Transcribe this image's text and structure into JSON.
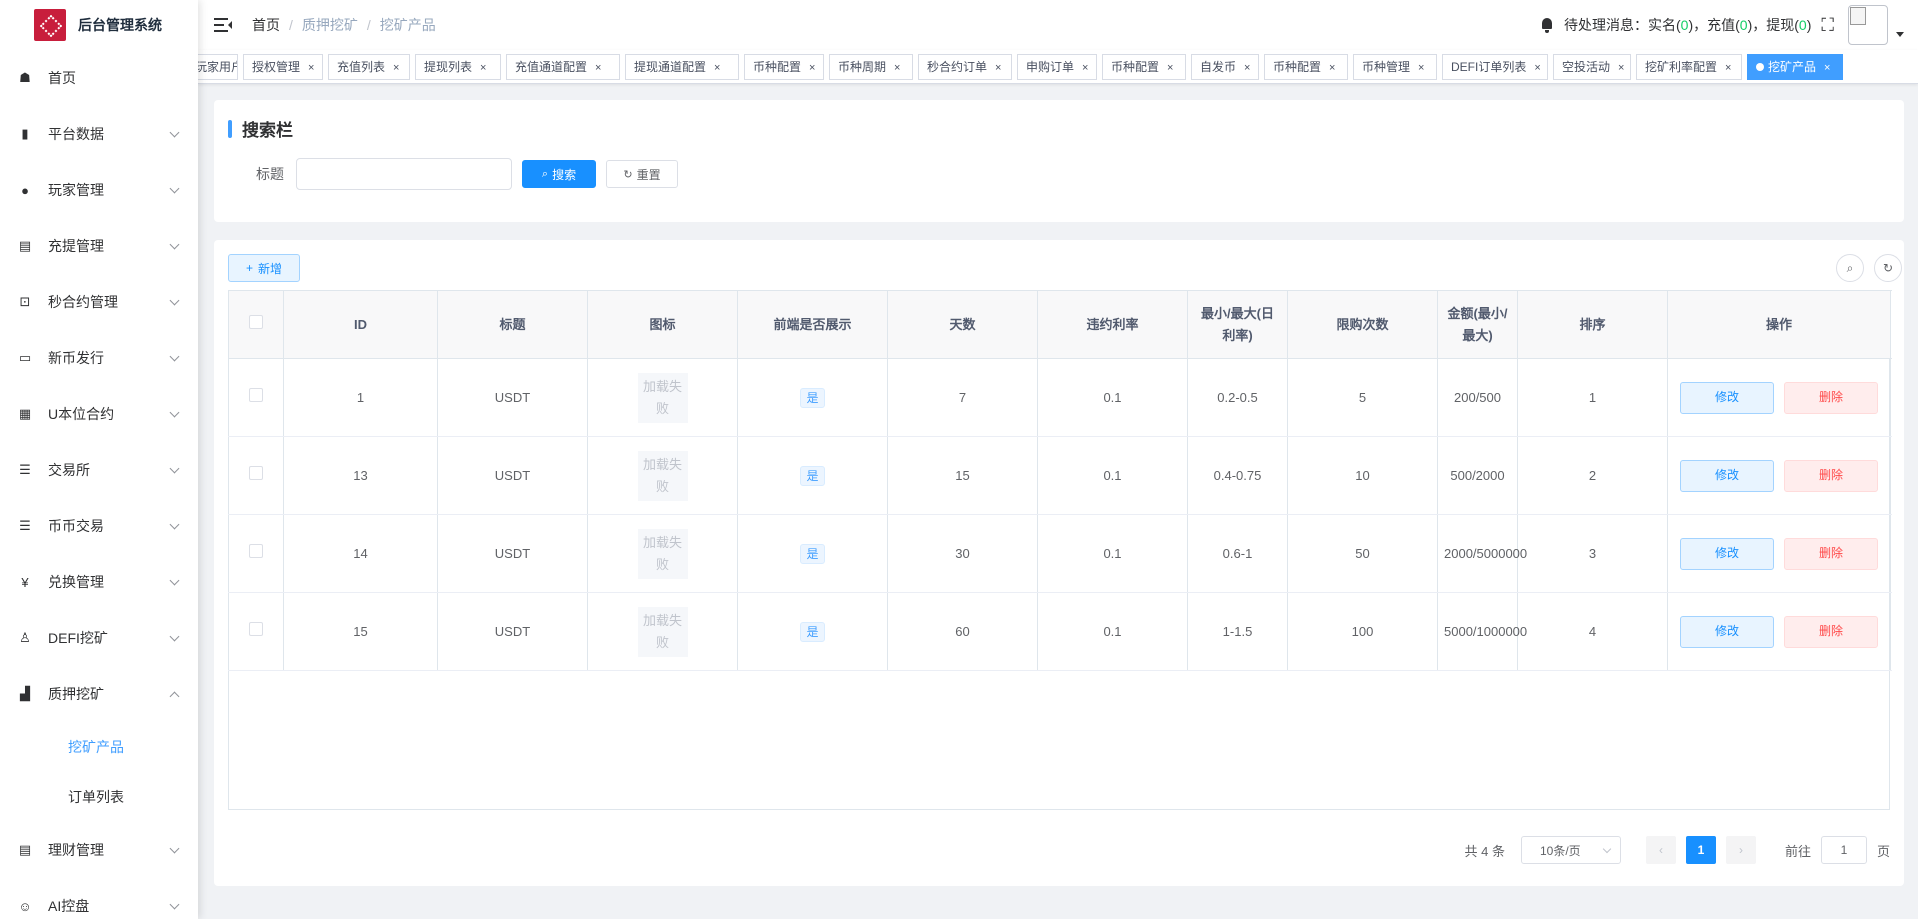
{
  "app": {
    "title": "后台管理系统"
  },
  "sidebar": {
    "items": [
      {
        "label": "首页",
        "icon": "dashboard-icon",
        "glyph": "☗",
        "expandable": false
      },
      {
        "label": "平台数据",
        "icon": "book-icon",
        "glyph": "▮",
        "expandable": true
      },
      {
        "label": "玩家管理",
        "icon": "user-icon",
        "glyph": "●",
        "expandable": true
      },
      {
        "label": "充提管理",
        "icon": "documents-icon",
        "glyph": "▤",
        "expandable": true
      },
      {
        "label": "秒合约管理",
        "icon": "monitor-chart-icon",
        "glyph": "⊡",
        "expandable": true
      },
      {
        "label": "新币发行",
        "icon": "edit-box-icon",
        "glyph": "▭",
        "expandable": true
      },
      {
        "label": "U本位合约",
        "icon": "grid-icon",
        "glyph": "▦",
        "expandable": true
      },
      {
        "label": "交易所",
        "icon": "list-icon",
        "glyph": "☰",
        "expandable": true
      },
      {
        "label": "币币交易",
        "icon": "list-bullet-icon",
        "glyph": "☰",
        "expandable": true
      },
      {
        "label": "兑换管理",
        "icon": "yen-icon",
        "glyph": "¥",
        "expandable": true
      },
      {
        "label": "DEFI挖矿",
        "icon": "person-tree-icon",
        "glyph": "♙",
        "expandable": true
      },
      {
        "label": "质押挖矿",
        "icon": "bar-chart-icon",
        "glyph": "▟",
        "expandable": true,
        "open": true
      }
    ],
    "sub_items": [
      {
        "label": "挖矿产品",
        "active": true
      },
      {
        "label": "订单列表",
        "active": false
      }
    ],
    "items_after": [
      {
        "label": "理财管理",
        "icon": "document-icon",
        "glyph": "▤",
        "expandable": true
      },
      {
        "label": "AI控盘",
        "icon": "robot-icon",
        "glyph": "☺",
        "expandable": true
      }
    ]
  },
  "header": {
    "breadcrumb": [
      "首页",
      "质押挖矿",
      "挖矿产品"
    ],
    "breadcrumb_sep": "/",
    "notice_prefix": "待处理消息：",
    "notice_items": [
      {
        "label": "实名",
        "count": "0"
      },
      {
        "label": "充值",
        "count": "0"
      },
      {
        "label": "提现",
        "count": "0"
      }
    ],
    "fullscreen_glyph": "⛶"
  },
  "tags": [
    {
      "label": "玩家用户",
      "active": false
    },
    {
      "label": "授权管理",
      "active": false
    },
    {
      "label": "充值列表",
      "active": false
    },
    {
      "label": "提现列表",
      "active": false
    },
    {
      "label": "充值通道配置",
      "active": false
    },
    {
      "label": "提现通道配置",
      "active": false
    },
    {
      "label": "币种配置",
      "active": false
    },
    {
      "label": "币种周期",
      "active": false
    },
    {
      "label": "秒合约订单",
      "active": false
    },
    {
      "label": "申购订单",
      "active": false
    },
    {
      "label": "币种配置",
      "active": false
    },
    {
      "label": "自发币",
      "active": false
    },
    {
      "label": "币种配置",
      "active": false
    },
    {
      "label": "币种管理",
      "active": false
    },
    {
      "label": "DEFI订单列表",
      "active": false
    },
    {
      "label": "空投活动",
      "active": false
    },
    {
      "label": "挖矿利率配置",
      "active": false
    },
    {
      "label": "挖矿产品",
      "active": true
    }
  ],
  "tag_close": "×",
  "search": {
    "section_title": "搜索栏",
    "field_label": "标题",
    "field_value": "",
    "field_placeholder": "",
    "search_label": "搜索",
    "reset_label": "重置"
  },
  "toolbar": {
    "add_label": "新增"
  },
  "table": {
    "columns": [
      "ID",
      "标题",
      "图标",
      "前端是否展示",
      "天数",
      "违约利率",
      "最小/最大(日利率)",
      "限购次数",
      "金额(最小/最大)",
      "排序",
      "操作"
    ],
    "rows": [
      {
        "id": "1",
        "title": "USDT",
        "icon": "加载失败",
        "show": "是",
        "days": "7",
        "penalty": "0.1",
        "rate": "0.2-0.5",
        "limit": "5",
        "amount": "200/500",
        "sort": "1"
      },
      {
        "id": "13",
        "title": "USDT",
        "icon": "加载失败",
        "show": "是",
        "days": "15",
        "penalty": "0.1",
        "rate": "0.4-0.75",
        "limit": "10",
        "amount": "500/2000",
        "sort": "2"
      },
      {
        "id": "14",
        "title": "USDT",
        "icon": "加载失败",
        "show": "是",
        "days": "30",
        "penalty": "0.1",
        "rate": "0.6-1",
        "limit": "50",
        "amount": "2000/5000000",
        "sort": "3"
      },
      {
        "id": "15",
        "title": "USDT",
        "icon": "加载失败",
        "show": "是",
        "days": "60",
        "penalty": "0.1",
        "rate": "1-1.5",
        "limit": "100",
        "amount": "5000/1000000",
        "sort": "4"
      }
    ],
    "edit_label": "修改",
    "delete_label": "删除"
  },
  "pagination": {
    "total": "共 4 条",
    "page_size": "10条/页",
    "current": "1",
    "goto_prefix": "前往",
    "goto_value": "1",
    "goto_suffix": "页"
  },
  "colors": {
    "primary": "#1890ff",
    "danger": "#ff4949",
    "success": "#13ce66",
    "logo": "#c81e3c"
  }
}
